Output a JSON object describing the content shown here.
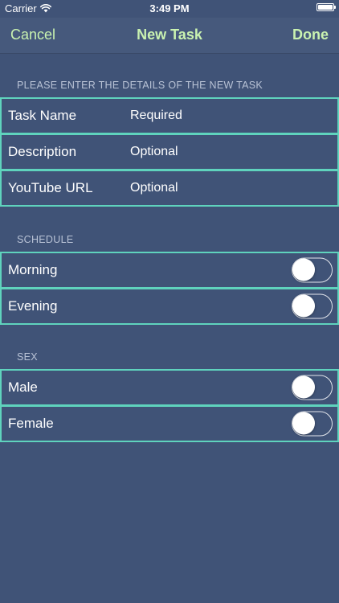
{
  "status_bar": {
    "carrier": "Carrier",
    "time": "3:49 PM",
    "icons": [
      "wifi-icon",
      "battery-icon"
    ]
  },
  "nav": {
    "cancel_label": "Cancel",
    "title": "New Task",
    "done_label": "Done"
  },
  "details_section": {
    "header": "PLEASE ENTER THE DETAILS OF THE NEW TASK",
    "fields": [
      {
        "label": "Task Name",
        "value": "Required"
      },
      {
        "label": "Description",
        "value": "Optional"
      },
      {
        "label": "YouTube URL",
        "value": "Optional"
      }
    ]
  },
  "schedule_section": {
    "header": "SCHEDULE",
    "toggles": [
      {
        "label": "Morning",
        "on": false
      },
      {
        "label": "Evening",
        "on": false
      }
    ]
  },
  "sex_section": {
    "header": "SEX",
    "toggles": [
      {
        "label": "Male",
        "on": false
      },
      {
        "label": "Female",
        "on": false
      }
    ]
  },
  "colors": {
    "background": "#405377",
    "accent": "#c9f2b0",
    "row_border": "#5fd3bd",
    "section_header_text": "#b9c3d6"
  }
}
